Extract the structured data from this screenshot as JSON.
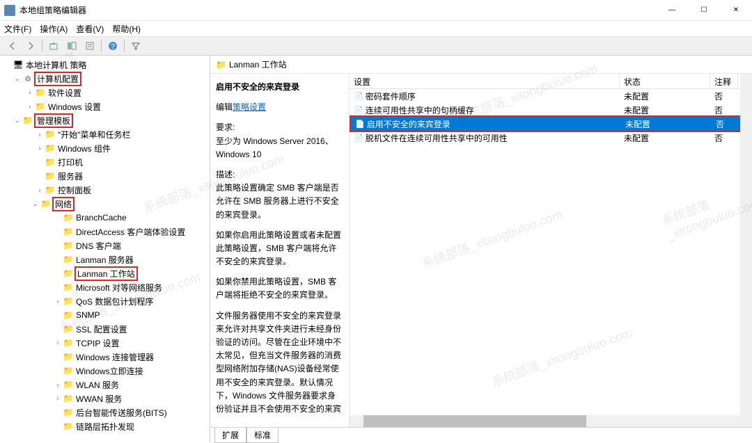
{
  "window": {
    "title": "本地组策略编辑器"
  },
  "menu": {
    "file": "文件(F)",
    "action": "操作(A)",
    "view": "查看(V)",
    "help": "帮助(H)"
  },
  "tree": {
    "root": "本地计算机 策略",
    "computer_config": "计算机配置",
    "software_settings": "软件设置",
    "windows_settings": "Windows 设置",
    "admin_templates": "管理模板",
    "start_taskbar": "\"开始\"菜单和任务栏",
    "windows_components": "Windows 组件",
    "printers": "打印机",
    "server": "服务器",
    "control_panel": "控制面板",
    "network": "网络",
    "branchcache": "BranchCache",
    "directaccess": "DirectAccess 客户端体验设置",
    "dns_client": "DNS 客户端",
    "lanman_server": "Lanman 服务器",
    "lanman_workstation": "Lanman 工作站",
    "ms_p2p": "Microsoft 对等网络服务",
    "qos": "QoS 数据包计划程序",
    "snmp": "SNMP",
    "ssl": "SSL 配置设置",
    "tcpip": "TCPIP 设置",
    "win_conn_mgr": "Windows 连接管理器",
    "win_conn_now": "Windows立即连接",
    "wlan": "WLAN 服务",
    "wwan": "WWAN 服务",
    "bits": "后台智能传送服务(BITS)",
    "lltd": "链路层拓扑发现"
  },
  "right": {
    "header": "Lanman 工作站",
    "detail_title": "启用不安全的来宾登录",
    "edit_prefix": "编辑",
    "edit_link": "策略设置",
    "req_label": "要求:",
    "req_value": "至少为 Windows Server 2016、Windows 10",
    "desc_label": "描述:",
    "desc_p1": "此策略设置确定 SMB 客户端是否允许在 SMB 服务器上进行不安全的来宾登录。",
    "desc_p2": "如果你启用此策略设置或者未配置此策略设置，SMB 客户端将允许不安全的来宾登录。",
    "desc_p3": "如果你禁用此策略设置，SMB 客户端将拒绝不安全的来宾登录。",
    "desc_p4": "文件服务器使用不安全的来宾登录来允许对共享文件夹进行未经身份验证的访问。尽管在企业环境中不太常见，但充当文件服务器的消费型网络附加存储(NAS)设备经常使用不安全的来宾登录。默认情况下，Windows 文件服务器要求身份验证并且不会使用不安全的来宾"
  },
  "columns": {
    "setting": "设置",
    "state": "状态",
    "comment": "注释"
  },
  "settings": [
    {
      "name": "密码套件顺序",
      "state": "未配置",
      "comment": "否"
    },
    {
      "name": "连续可用性共享中的句柄缓存",
      "state": "未配置",
      "comment": "否"
    },
    {
      "name": "启用不安全的来宾登录",
      "state": "未配置",
      "comment": "否"
    },
    {
      "name": "脱机文件在连续可用性共享中的可用性",
      "state": "未配置",
      "comment": "否"
    }
  ],
  "tabs": {
    "extended": "扩展",
    "standard": "标准"
  }
}
